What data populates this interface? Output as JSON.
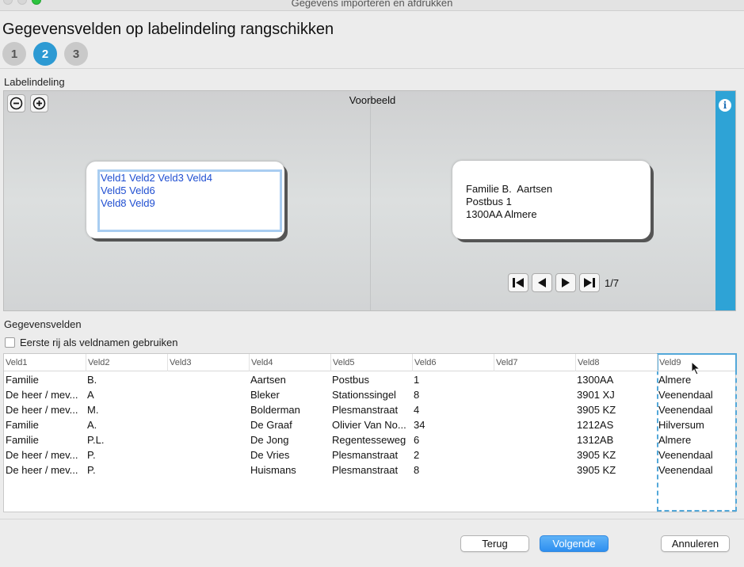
{
  "window": {
    "title": "Gegevens importeren en afdrukken"
  },
  "page": {
    "title": "Gegevensvelden op labelindeling rangschikken"
  },
  "steps": [
    "1",
    "2",
    "3"
  ],
  "active_step": "2",
  "layout_section": {
    "label": "Labelindeling"
  },
  "preview": {
    "title": "Voorbeeld",
    "layout_lines": [
      "Veld1 Veld2 Veld3 Veld4",
      "Veld5 Veld6",
      "Veld8 Veld9"
    ],
    "sample_lines": [
      "Familie B.  Aartsen",
      "Postbus 1",
      "1300AA Almere"
    ],
    "record_counter": "1/7"
  },
  "fields_section": {
    "label": "Gegevensvelden",
    "first_row_checkbox_label": "Eerste rij als veldnamen gebruiken"
  },
  "table": {
    "columns": [
      "Veld1",
      "Veld2",
      "Veld3",
      "Veld4",
      "Veld5",
      "Veld6",
      "Veld7",
      "Veld8",
      "Veld9"
    ],
    "rows": [
      [
        "Familie",
        "B.",
        "",
        "Aartsen",
        "Postbus",
        "1",
        "",
        "1300AA",
        "Almere"
      ],
      [
        "De heer / mev...",
        "A",
        "",
        "Bleker",
        "Stationssingel",
        "8",
        "",
        "3901 XJ",
        "Veenendaal"
      ],
      [
        "De heer / mev...",
        "M.",
        "",
        "Bolderman",
        "Plesmanstraat",
        "4",
        "",
        "3905 KZ",
        "Veenendaal"
      ],
      [
        "Familie",
        "A.",
        "",
        "De Graaf",
        "Olivier Van No...",
        "34",
        "",
        "1212AS",
        "Hilversum"
      ],
      [
        "Familie",
        "P.L.",
        "",
        "De Jong",
        "Regentesseweg",
        "6",
        "",
        "1312AB",
        "Almere"
      ],
      [
        "De heer / mev...",
        "P.",
        "",
        "De Vries",
        "Plesmanstraat",
        "2",
        "",
        "3905 KZ",
        "Veenendaal"
      ],
      [
        "De heer / mev...",
        "P.",
        "",
        "Huismans",
        "Plesmanstraat",
        "8",
        "",
        "3905 KZ",
        "Veenendaal"
      ]
    ],
    "selected_column": "Veld9"
  },
  "footer": {
    "back": "Terug",
    "next": "Volgende",
    "cancel": "Annuleren"
  },
  "icons": {
    "zoom_out": "zoom-out-icon",
    "zoom_in": "zoom-in-icon",
    "info": "info-icon",
    "first": "first-record-icon",
    "prev": "previous-record-icon",
    "next": "next-record-icon",
    "last": "last-record-icon"
  },
  "colors": {
    "accent": "#2d9ad3",
    "info_bar": "#2ea3d6",
    "layout_text": "#1f4ed1",
    "primary_button": "#2e8ff0"
  }
}
